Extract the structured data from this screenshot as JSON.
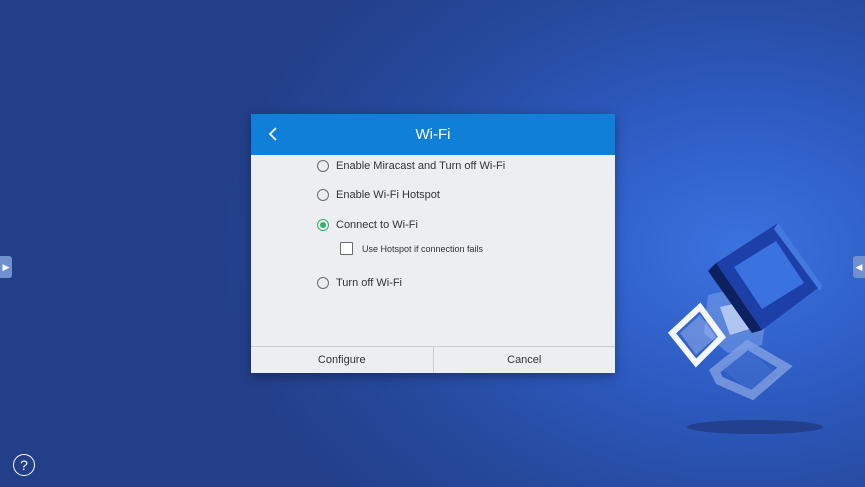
{
  "dialog": {
    "title": "Wi-Fi",
    "options": [
      {
        "label": "Enable Miracast and Turn off Wi-Fi",
        "selected": false
      },
      {
        "label": "Enable Wi-Fi Hotspot",
        "selected": false
      },
      {
        "label": "Connect to Wi-Fi",
        "selected": true
      },
      {
        "label": "Turn off Wi-Fi",
        "selected": false
      }
    ],
    "hotspot_fallback": {
      "label": "Use Hotspot if connection fails",
      "checked": false
    },
    "buttons": {
      "configure": "Configure",
      "cancel": "Cancel"
    }
  },
  "desktop": {
    "help_icon": "?",
    "left_handle_icon": "▶",
    "right_handle_icon": "◀"
  },
  "colors": {
    "header": "#0f7fd8",
    "selected_radio": "#34b36b",
    "dialog_bg": "#eceef1"
  }
}
